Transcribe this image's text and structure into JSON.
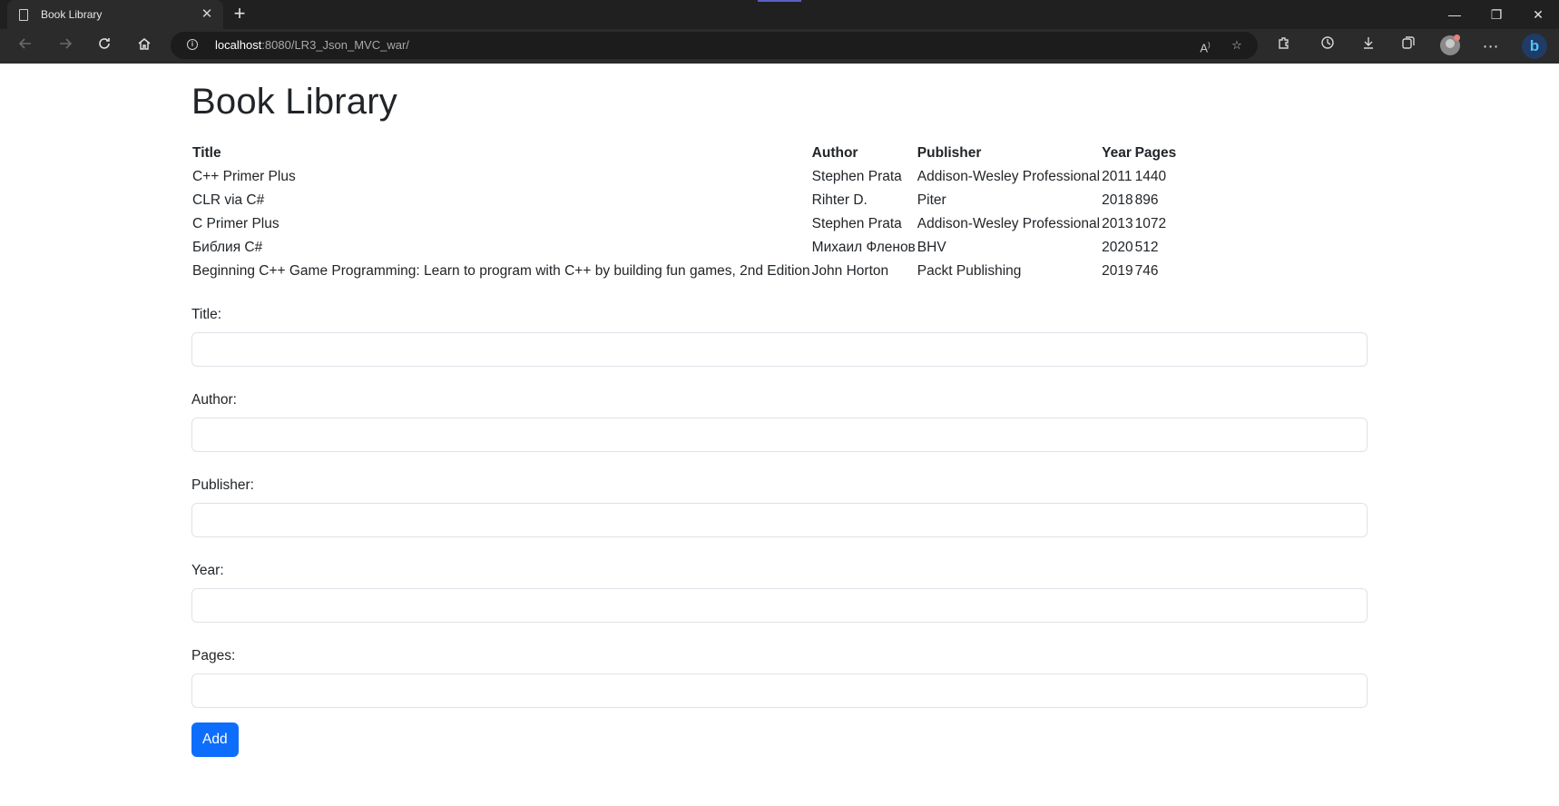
{
  "browser": {
    "tab_title": "Book Library",
    "tab_close": "✕",
    "new_tab": "+",
    "url_host": "localhost",
    "url_rest": ":8080/LR3_Json_MVC_war/",
    "window": {
      "minimize": "—",
      "restore": "❐",
      "close": "✕"
    },
    "icons": [
      "back-icon",
      "forward-icon",
      "refresh-icon",
      "home-icon",
      "info-icon",
      "read-aloud-icon",
      "favorite-add-icon",
      "extensions-icon",
      "history-icon",
      "download-icon",
      "collections-icon",
      "profile-icon",
      "more-icon",
      "bing-icon"
    ]
  },
  "page": {
    "heading": "Book Library",
    "table": {
      "headers": [
        "Title",
        "Author",
        "Publisher",
        "Year",
        "Pages"
      ],
      "rows": [
        [
          "C++ Primer Plus",
          "Stephen Prata",
          "Addison-Wesley Professional",
          "2011",
          "1440"
        ],
        [
          "CLR via C#",
          "Rihter D.",
          "Piter",
          "2018",
          "896"
        ],
        [
          "C Primer Plus",
          "Stephen Prata",
          "Addison-Wesley Professional",
          "2013",
          "1072"
        ],
        [
          "Библия C#",
          "Михаил Фленов",
          "BHV",
          "2020",
          "512"
        ],
        [
          "Beginning C++ Game Programming: Learn to program with C++ by building fun games, 2nd Edition",
          "John Horton",
          "Packt Publishing",
          "2019",
          "746"
        ]
      ]
    },
    "form": {
      "title_label": "Title:",
      "title_value": "",
      "author_label": "Author:",
      "author_value": "",
      "publisher_label": "Publisher:",
      "publisher_value": "",
      "year_label": "Year:",
      "year_value": "",
      "pages_label": "Pages:",
      "pages_value": "",
      "add_label": "Add"
    },
    "colors": {
      "accent": "#0d6efd",
      "text": "#212529",
      "chrome_dark": "#202020"
    }
  }
}
